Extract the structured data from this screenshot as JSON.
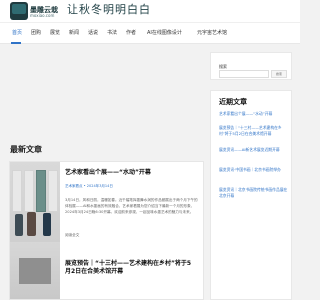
{
  "header": {
    "logo_text": "墨雕云栽",
    "logo_subtitle": "moxiao.com",
    "slogan": "让秋冬明明白白"
  },
  "nav": {
    "items": [
      {
        "label": "首页",
        "active": true
      },
      {
        "label": "团购",
        "active": false
      },
      {
        "label": "展览",
        "active": false
      },
      {
        "label": "新闻",
        "active": false
      },
      {
        "label": "话说",
        "active": false
      },
      {
        "label": "书法",
        "active": false
      },
      {
        "label": "作者",
        "active": false
      },
      {
        "label": "AI在线图像设计",
        "active": false
      },
      {
        "label": "元宇宙艺术馆",
        "active": false
      }
    ]
  },
  "main": {
    "section_title": "最新文章",
    "articles": [
      {
        "title": "艺术家看出个展——“水动”开幕",
        "meta": "艺术家看点 • 2024年3月14日",
        "excerpt": "3月14日，风和日丽，温暖如春。近千幅笔挥墨舞水润的作品都展出于两个月下午的体验展——AI和水墨画的有效融合，艺术家看展为您介绍当下最新一个月的形象，2024年3月24日晚6:30开幕。欢迎前来参观，一起品味水墨艺术的魅力与未来。",
        "read_more": "阅读全文"
      },
      {
        "title": "展览预告｜“十三村——艺术建构在乡村”将于5月2日在合美术馆开幕"
      }
    ]
  },
  "sidebar": {
    "search": {
      "label": "搜索",
      "placeholder": "",
      "button": "搜索"
    },
    "recent": {
      "title": "近期文章",
      "items": [
        "艺术家看出个展——“水动”开幕",
        "展览预告｜“十三村——艺术建构在乡村”将于5月2日在合美术馆开幕",
        "展览资讯——AI新艺术展览近期开幕",
        "展览资讯·中国书画｜北京书画院举办",
        "展览资讯｜北京书画院传统书画作品展在北京开幕"
      ]
    }
  },
  "colors": {
    "accent": "#2f73c7",
    "nav_text": "#333333",
    "logo_bg": "#1f3b3f"
  }
}
